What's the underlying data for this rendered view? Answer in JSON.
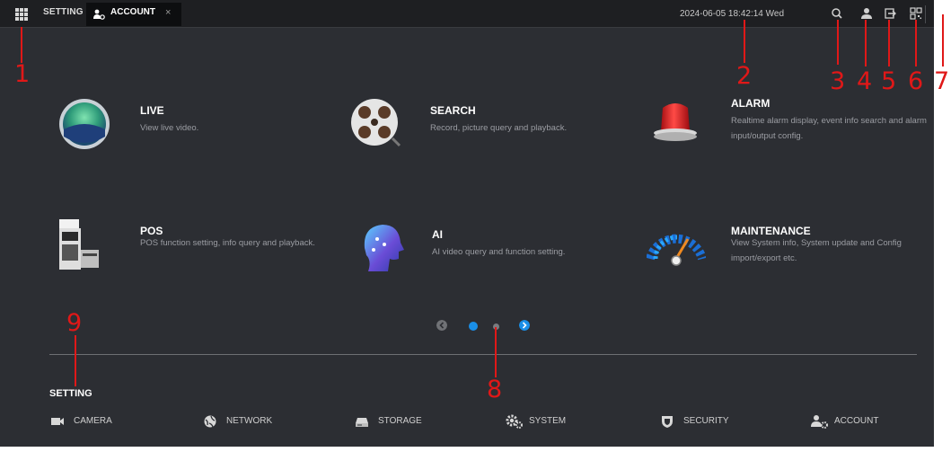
{
  "topbar": {
    "setting_tab": "SETTING",
    "account_tab": "ACCOUNT",
    "close_glyph": "×",
    "clock": "2024-06-05 18:42:14 Wed",
    "icons": [
      "search-icon",
      "user-icon",
      "logout-icon",
      "qr-code-icon",
      "display-icon"
    ]
  },
  "modules": [
    {
      "title": "LIVE",
      "desc": "View live video."
    },
    {
      "title": "SEARCH",
      "desc": "Record, picture query and playback."
    },
    {
      "title": "ALARM",
      "desc": "Realtime alarm display, event info search and alarm input/output config."
    },
    {
      "title": "POS",
      "desc": "POS function setting, info query and playback."
    },
    {
      "title": "AI",
      "desc": "AI video query and function setting."
    },
    {
      "title": "MAINTENANCE",
      "desc": "View System info, System update and Config import/export etc."
    }
  ],
  "pager": {
    "pages": 2,
    "current": 1
  },
  "setting": {
    "heading": "SETTING",
    "items": [
      {
        "label": "CAMERA",
        "icon": "camera-icon"
      },
      {
        "label": "NETWORK",
        "icon": "network-icon"
      },
      {
        "label": "STORAGE",
        "icon": "storage-icon"
      },
      {
        "label": "SYSTEM",
        "icon": "system-gear-icon"
      },
      {
        "label": "SECURITY",
        "icon": "shield-icon"
      },
      {
        "label": "ACCOUNT",
        "icon": "account-icon"
      }
    ]
  },
  "annotations": [
    "1",
    "2",
    "3",
    "4",
    "5",
    "6",
    "7",
    "8",
    "9"
  ],
  "colors": {
    "accent": "#1a8fe8",
    "background": "#2c2e33",
    "topbar": "#1e1f22",
    "annotation": "#e01818"
  }
}
